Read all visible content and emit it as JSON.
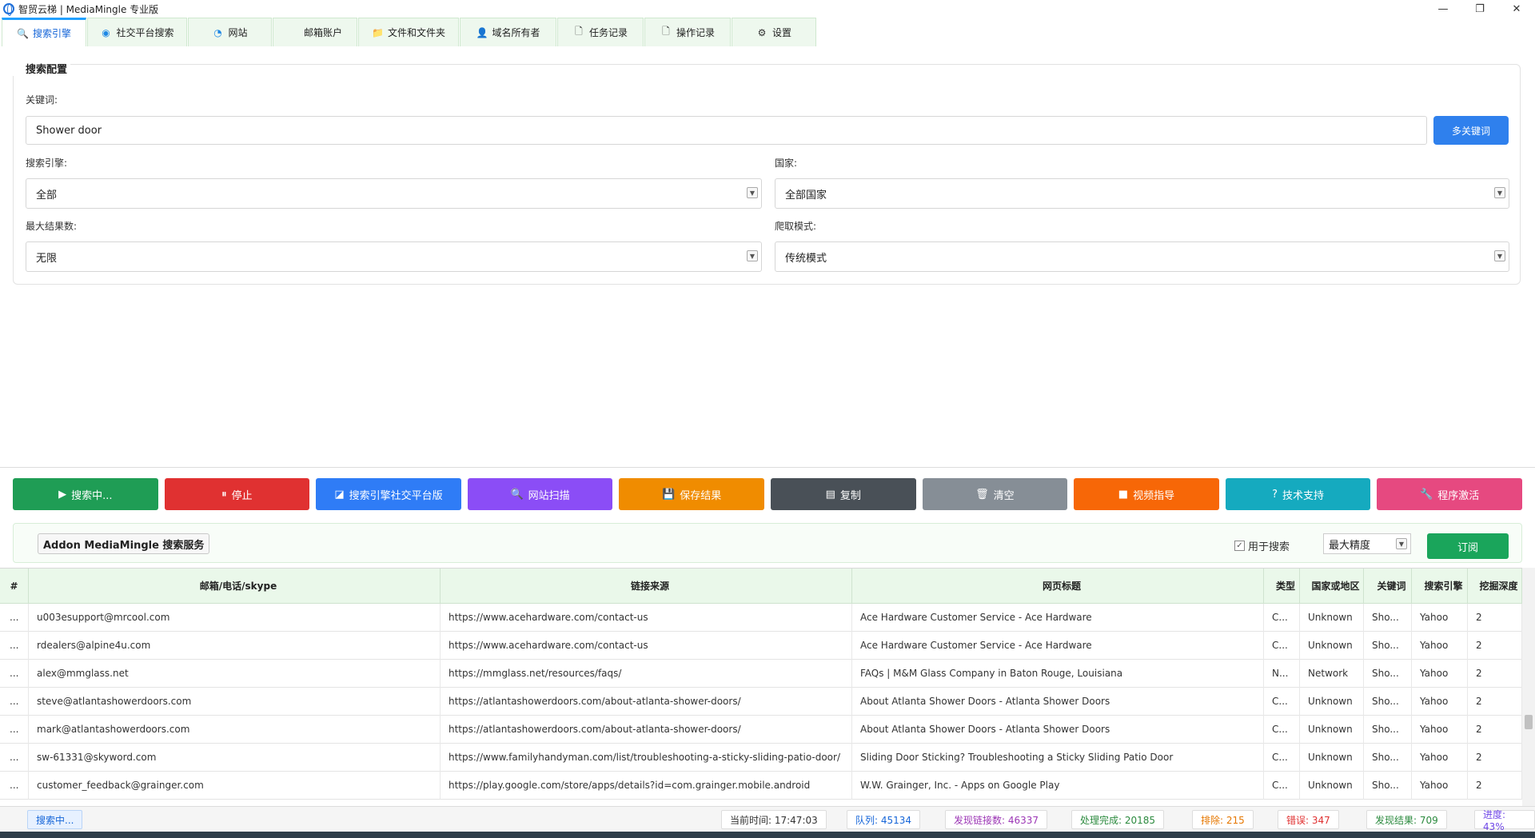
{
  "app": {
    "title": "智贸云梯 | MediaMingle 专业版"
  },
  "window_buttons": {
    "minimize": "—",
    "restore": "❐",
    "close": "✕"
  },
  "tabs": [
    {
      "label": "搜索引擎",
      "icon": "search-icon",
      "glyph": "🔍",
      "active": true
    },
    {
      "label": "社交平台搜索",
      "icon": "social-icon",
      "glyph": "◉",
      "active": false
    },
    {
      "label": "网站",
      "icon": "globe-icon",
      "glyph": "◔",
      "active": false
    },
    {
      "label": "邮箱账户",
      "icon": "mail-icon",
      "glyph": "",
      "active": false
    },
    {
      "label": "文件和文件夹",
      "icon": "folder-icon",
      "glyph": "📁",
      "active": false
    },
    {
      "label": "域名所有者",
      "icon": "user-icon",
      "glyph": "👤",
      "active": false
    },
    {
      "label": "任务记录",
      "icon": "document-icon",
      "glyph": "🗋",
      "active": false
    },
    {
      "label": "操作记录",
      "icon": "log-icon",
      "glyph": "🗋",
      "active": false
    },
    {
      "label": "设置",
      "icon": "gear-icon",
      "glyph": "⚙",
      "active": false
    }
  ],
  "config": {
    "title": "搜索配置",
    "keyword_label": "关键词:",
    "keyword_value": "Shower door",
    "multi_keyword_button": "多关键词",
    "engine_label": "搜索引擎:",
    "engine_value": "全部",
    "country_label": "国家:",
    "country_value": "全部国家",
    "max_results_label": "最大结果数:",
    "max_results_value": "无限",
    "crawl_mode_label": "爬取模式:",
    "crawl_mode_value": "传统模式"
  },
  "actions": [
    {
      "label": "搜索中...",
      "glyph": "▶",
      "color": "#1f9d55",
      "name": "search-running-button",
      "icon": "play-icon"
    },
    {
      "label": "停止",
      "glyph": "⏸",
      "color": "#e03131",
      "name": "stop-button",
      "icon": "pause-icon"
    },
    {
      "label": "搜索引擎社交平台版",
      "glyph": "◪",
      "color": "#2f7cf6",
      "name": "social-edition-button",
      "icon": "window-icon"
    },
    {
      "label": "网站扫描",
      "glyph": "🔍",
      "color": "#8b4df6",
      "name": "website-scan-button",
      "icon": "search-icon"
    },
    {
      "label": "保存结果",
      "glyph": "💾",
      "color": "#f08c00",
      "name": "save-results-button",
      "icon": "save-icon"
    },
    {
      "label": "复制",
      "glyph": "▤",
      "color": "#495057",
      "name": "copy-button",
      "icon": "copy-icon"
    },
    {
      "label": "清空",
      "glyph": "🗑",
      "color": "#868e96",
      "name": "clear-button",
      "icon": "trash-icon"
    },
    {
      "label": "视频指导",
      "glyph": "■",
      "color": "#f76707",
      "name": "video-guide-button",
      "icon": "video-icon"
    },
    {
      "label": "技术支持",
      "glyph": "?",
      "color": "#15aabf",
      "name": "tech-support-button",
      "icon": "help-icon"
    },
    {
      "label": "程序激活",
      "glyph": "🔧",
      "color": "#e64980",
      "name": "activate-button",
      "icon": "wrench-icon"
    }
  ],
  "addon": {
    "title": "Addon MediaMingle 搜索服务",
    "checkbox_label": "用于搜索",
    "precision_value": "最大精度",
    "subscribe_button": "订阅"
  },
  "table": {
    "headers": [
      "#",
      "邮箱/电话/skype",
      "链接来源",
      "网页标题",
      "类型",
      "国家或地区",
      "关键词",
      "搜索引擎",
      "挖掘深度"
    ],
    "rows": [
      [
        "...",
        "u003esupport@mrcool.com",
        "https://www.acehardware.com/contact-us",
        "Ace Hardware Customer Service -  Ace Hardware",
        "C...",
        "Unknown",
        "Sho...",
        "Yahoo",
        "2"
      ],
      [
        "...",
        "rdealers@alpine4u.com",
        "https://www.acehardware.com/contact-us",
        "Ace Hardware Customer Service -  Ace Hardware",
        "C...",
        "Unknown",
        "Sho...",
        "Yahoo",
        "2"
      ],
      [
        "...",
        "alex@mmglass.net",
        "https://mmglass.net/resources/faqs/",
        "FAQs | M&M Glass Company in Baton Rouge, Louisiana",
        "N...",
        "Network",
        "Sho...",
        "Yahoo",
        "2"
      ],
      [
        "...",
        "steve@atlantashowerdoors.com",
        "https://atlantashowerdoors.com/about-atlanta-shower-doors/",
        "About Atlanta Shower Doors - Atlanta Shower Doors",
        "C...",
        "Unknown",
        "Sho...",
        "Yahoo",
        "2"
      ],
      [
        "...",
        "mark@atlantashowerdoors.com",
        "https://atlantashowerdoors.com/about-atlanta-shower-doors/",
        "About Atlanta Shower Doors - Atlanta Shower Doors",
        "C...",
        "Unknown",
        "Sho...",
        "Yahoo",
        "2"
      ],
      [
        "...",
        "sw-61331@skyword.com",
        "https://www.familyhandyman.com/list/troubleshooting-a-sticky-sliding-patio-door/",
        "Sliding Door Sticking? Troubleshooting a Sticky Sliding Patio Door",
        "C...",
        "Unknown",
        "Sho...",
        "Yahoo",
        "2"
      ],
      [
        "...",
        "customer_feedback@grainger.com",
        "https://play.google.com/store/apps/details?id=com.grainger.mobile.android",
        "W.W. Grainger, Inc. - Apps on Google Play",
        "C...",
        "Unknown",
        "Sho...",
        "Yahoo",
        "2"
      ]
    ]
  },
  "status": {
    "state": "搜索中...",
    "current_time": "当前时间: 17:47:03",
    "queue": "队列: 45134",
    "found_links": "发现链接数: 46337",
    "processed": "处理完成: 20185",
    "excluded": "排除: 215",
    "errors": "错误: 347",
    "found_results": "发现结果: 709",
    "progress": "进度: 43%"
  },
  "colors": {
    "accent_blue": "#2f80ed",
    "tab_active": "#1565d8",
    "subscribe_green": "#1aa55b",
    "queue_blue": "#1565d8",
    "found_links_purple": "#9c36b5",
    "processed_green": "#2b8a3e",
    "excluded_orange": "#e67700",
    "errors_red": "#e03131",
    "found_results_green": "#2b8a3e",
    "progress_purple": "#7048e8"
  }
}
